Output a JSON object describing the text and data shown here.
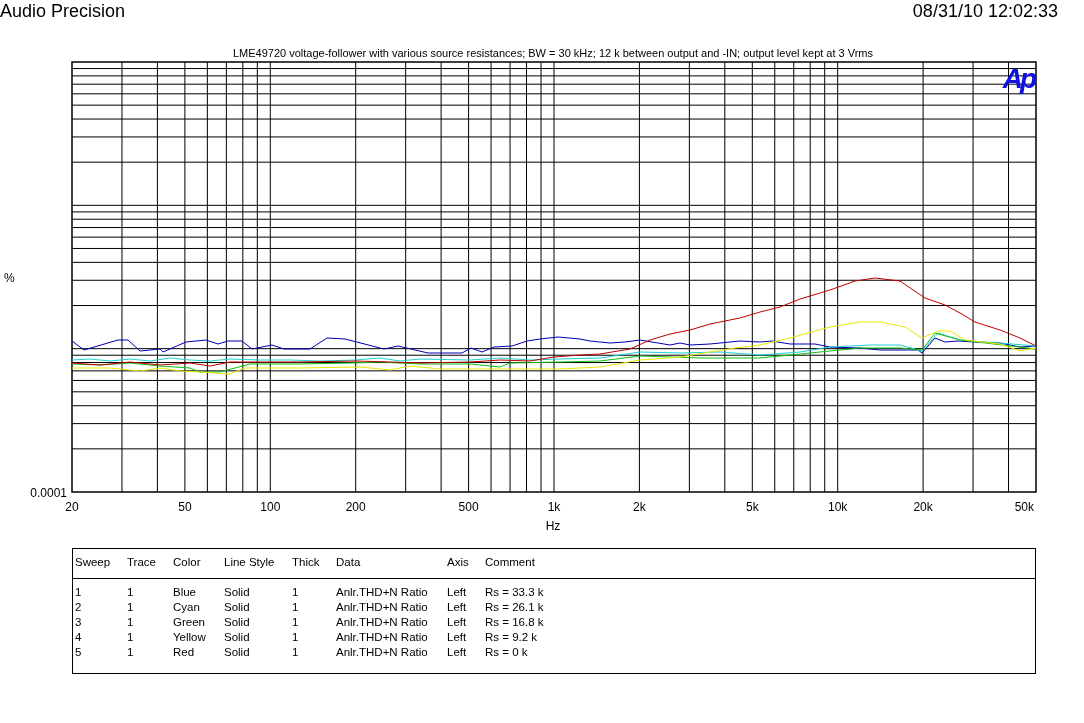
{
  "header": {
    "title": "Audio Precision",
    "timestamp": "08/31/10 12:02:33"
  },
  "plot": {
    "title": "LME49720 voltage-follower with various source resistances; BW = 30 kHz; 12 k between output and -IN; output level kept at 3 Vrms",
    "logo": "Ap",
    "y_unit": "%",
    "y_tick": "0.0001",
    "x_label": "Hz",
    "x_ticks": [
      "20",
      "50",
      "100",
      "200",
      "500",
      "1k",
      "2k",
      "5k",
      "10k",
      "20k",
      "50k"
    ]
  },
  "legend": {
    "columns": [
      "Sweep",
      "Trace",
      "Color",
      "Line Style",
      "Thick",
      "Data",
      "Axis",
      "Comment"
    ],
    "rows": [
      [
        "1",
        "1",
        "Blue",
        "Solid",
        "1",
        "Anlr.THD+N Ratio",
        "Left",
        "Rs = 33.3 k"
      ],
      [
        "2",
        "1",
        "Cyan",
        "Solid",
        "1",
        "Anlr.THD+N Ratio",
        "Left",
        "Rs = 26.1 k"
      ],
      [
        "3",
        "1",
        "Green",
        "Solid",
        "1",
        "Anlr.THD+N Ratio",
        "Left",
        "Rs = 16.8 k"
      ],
      [
        "4",
        "1",
        "Yellow",
        "Solid",
        "1",
        "Anlr.THD+N Ratio",
        "Left",
        "Rs = 9.2 k"
      ],
      [
        "5",
        "1",
        "Red",
        "Solid",
        "1",
        "Anlr.THD+N Ratio",
        "Left",
        "Rs = 0 k"
      ]
    ]
  }
}
